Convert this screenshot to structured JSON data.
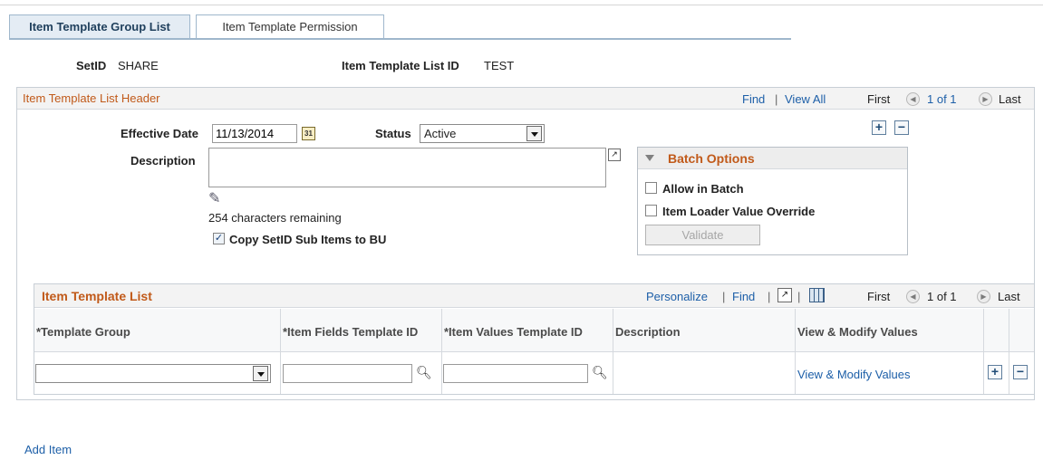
{
  "tabs": [
    {
      "label": "Item Template Group List"
    },
    {
      "label": "Item Template Permission"
    }
  ],
  "header": {
    "setid_label": "SetID",
    "setid_value": "SHARE",
    "list_id_label": "Item Template List ID",
    "list_id_value": "TEST"
  },
  "list_header": {
    "title": "Item Template List Header",
    "find": "Find",
    "separator": "|",
    "view_all": "View All",
    "first": "First",
    "count": "1 of 1",
    "last": "Last"
  },
  "form": {
    "effective_date_label": "Effective Date",
    "effective_date_value": "11/13/2014",
    "status_label": "Status",
    "status_value": "Active",
    "description_label": "Description",
    "description_value": "",
    "chars_remaining": "254 characters remaining",
    "copy_setid_label": "Copy SetID Sub Items to BU"
  },
  "batch": {
    "title": "Batch Options",
    "allow_in_batch": "Allow in Batch",
    "item_loader_override": "Item Loader Value Override",
    "validate_button": "Validate"
  },
  "template_list": {
    "title": "Item Template List",
    "personalize": "Personalize",
    "find": "Find",
    "first": "First",
    "count": "1 of 1",
    "last": "Last",
    "columns": [
      "*Template Group",
      "*Item Fields Template ID",
      "*Item Values Template ID",
      "Description",
      "View & Modify Values"
    ],
    "row": {
      "template_group": "",
      "item_fields_template_id": "",
      "item_values_template_id": "",
      "description": "",
      "view_modify_link": "View & Modify Values"
    }
  },
  "footer": {
    "add_item": "Add Item"
  },
  "colors": {
    "accent_orange": "#c15a1a",
    "link_blue": "#1d5fa8",
    "tab_active_bg": "#e4ecf4"
  }
}
